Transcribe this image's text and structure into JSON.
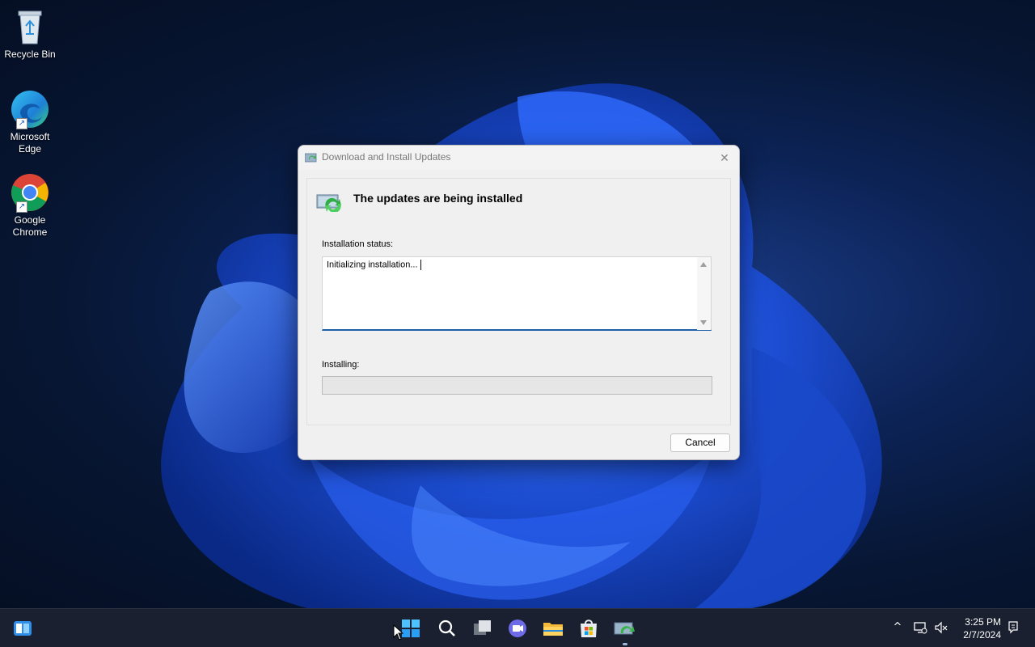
{
  "desktop": {
    "icons": [
      {
        "label": "Recycle Bin",
        "icon": "recycle-bin-icon"
      },
      {
        "label": "Microsoft Edge",
        "icon": "edge-icon"
      },
      {
        "label": "Google Chrome",
        "icon": "chrome-icon"
      }
    ]
  },
  "dialog": {
    "title": "Download and Install Updates",
    "heading": "The updates are being installed",
    "status_label": "Installation status:",
    "status_text": "Initializing installation...",
    "installing_label": "Installing:",
    "progress": 0,
    "cancel_label": "Cancel"
  },
  "taskbar": {
    "pinned": [
      "widgets-icon",
      "start-icon",
      "search-icon",
      "task-view-icon",
      "chat-icon",
      "file-explorer-icon",
      "store-icon",
      "update-installer-icon"
    ],
    "time": "3:25 PM",
    "date": "2/7/2024"
  },
  "colors": {
    "accent": "#1f5fa8",
    "taskbar": "#1a2030",
    "desktop": "#0c2356"
  }
}
